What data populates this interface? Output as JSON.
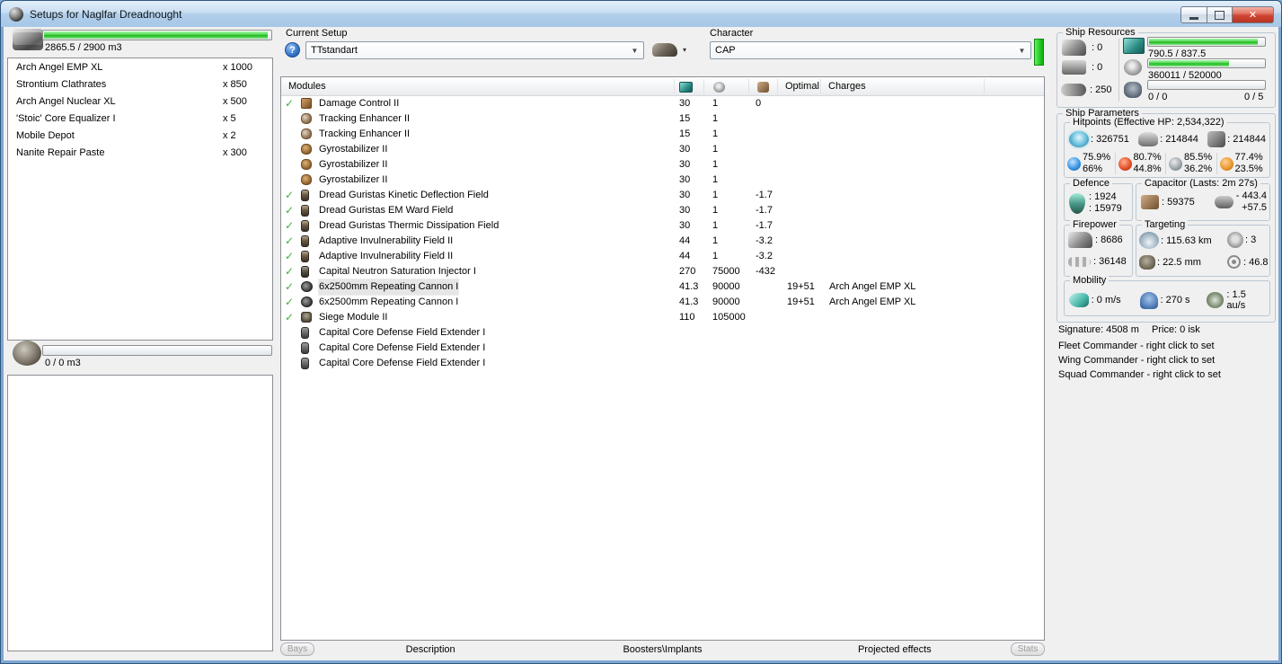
{
  "window": {
    "title": "Setups for Naglfar Dreadnought"
  },
  "left_panel": {
    "cargo": {
      "capacity_label": "2865.5 / 2900 m3",
      "fill_pct": 98.8,
      "items": [
        {
          "name": "Arch Angel EMP XL",
          "qty": "x 1000"
        },
        {
          "name": "Strontium Clathrates",
          "qty": "x 850"
        },
        {
          "name": "Arch Angel Nuclear XL",
          "qty": "x 500"
        },
        {
          "name": "'Stoic' Core Equalizer I",
          "qty": "x 5"
        },
        {
          "name": "Mobile Depot",
          "qty": "x 2"
        },
        {
          "name": "Nanite Repair Paste",
          "qty": "x 300"
        }
      ]
    },
    "drone_bay": {
      "capacity_label": "0 / 0 m3",
      "fill_pct": 0
    }
  },
  "setup_bar": {
    "current_setup_label": "Current Setup",
    "setup_value": "TTstandart",
    "character_label": "Character",
    "character_value": "CAP"
  },
  "modules_table": {
    "title": "Modules",
    "columns": {
      "optimal": "Optimal",
      "charges": "Charges"
    },
    "rows": [
      {
        "active": true,
        "selected": false,
        "icon": "damage-control-icon",
        "name": "Damage Control II",
        "cpu": "30",
        "pg": "1",
        "cap": "0",
        "optimal": "",
        "charges": ""
      },
      {
        "active": false,
        "selected": false,
        "icon": "tracking-enhancer-icon",
        "name": "Tracking Enhancer II",
        "cpu": "15",
        "pg": "1",
        "cap": "",
        "optimal": "",
        "charges": ""
      },
      {
        "active": false,
        "selected": false,
        "icon": "tracking-enhancer-icon",
        "name": "Tracking Enhancer II",
        "cpu": "15",
        "pg": "1",
        "cap": "",
        "optimal": "",
        "charges": ""
      },
      {
        "active": false,
        "selected": false,
        "icon": "gyrostabilizer-icon",
        "name": "Gyrostabilizer II",
        "cpu": "30",
        "pg": "1",
        "cap": "",
        "optimal": "",
        "charges": ""
      },
      {
        "active": false,
        "selected": false,
        "icon": "gyrostabilizer-icon",
        "name": "Gyrostabilizer II",
        "cpu": "30",
        "pg": "1",
        "cap": "",
        "optimal": "",
        "charges": ""
      },
      {
        "active": false,
        "selected": false,
        "icon": "gyrostabilizer-icon",
        "name": "Gyrostabilizer II",
        "cpu": "30",
        "pg": "1",
        "cap": "",
        "optimal": "",
        "charges": ""
      },
      {
        "active": true,
        "selected": false,
        "icon": "shield-hardener-icon",
        "name": "Dread Guristas Kinetic Deflection Field",
        "cpu": "30",
        "pg": "1",
        "cap": "-1.7",
        "optimal": "",
        "charges": ""
      },
      {
        "active": true,
        "selected": false,
        "icon": "shield-hardener-icon",
        "name": "Dread Guristas EM Ward Field",
        "cpu": "30",
        "pg": "1",
        "cap": "-1.7",
        "optimal": "",
        "charges": ""
      },
      {
        "active": true,
        "selected": false,
        "icon": "shield-hardener-icon",
        "name": "Dread Guristas Thermic Dissipation Field",
        "cpu": "30",
        "pg": "1",
        "cap": "-1.7",
        "optimal": "",
        "charges": ""
      },
      {
        "active": true,
        "selected": false,
        "icon": "shield-hardener-icon",
        "name": "Adaptive Invulnerability Field II",
        "cpu": "44",
        "pg": "1",
        "cap": "-3.2",
        "optimal": "",
        "charges": ""
      },
      {
        "active": true,
        "selected": false,
        "icon": "shield-hardener-icon",
        "name": "Adaptive Invulnerability Field II",
        "cpu": "44",
        "pg": "1",
        "cap": "-3.2",
        "optimal": "",
        "charges": ""
      },
      {
        "active": true,
        "selected": false,
        "icon": "injector-icon",
        "name": "Capital Neutron Saturation Injector I",
        "cpu": "270",
        "pg": "75000",
        "cap": "-432",
        "optimal": "",
        "charges": ""
      },
      {
        "active": true,
        "selected": true,
        "icon": "cannon-icon",
        "name": "6x2500mm Repeating Cannon I",
        "cpu": "41.3",
        "pg": "90000",
        "cap": "",
        "optimal": "19+51",
        "charges": "Arch Angel EMP XL"
      },
      {
        "active": true,
        "selected": false,
        "icon": "cannon-icon",
        "name": "6x2500mm Repeating Cannon I",
        "cpu": "41.3",
        "pg": "90000",
        "cap": "",
        "optimal": "19+51",
        "charges": "Arch Angel EMP XL"
      },
      {
        "active": true,
        "selected": false,
        "icon": "siege-module-icon",
        "name": "Siege Module II",
        "cpu": "110",
        "pg": "105000",
        "cap": "",
        "optimal": "",
        "charges": ""
      },
      {
        "active": false,
        "selected": false,
        "icon": "rig-icon",
        "name": "Capital Core Defense Field Extender I",
        "cpu": "",
        "pg": "",
        "cap": "",
        "optimal": "",
        "charges": ""
      },
      {
        "active": false,
        "selected": false,
        "icon": "rig-icon",
        "name": "Capital Core Defense Field Extender I",
        "cpu": "",
        "pg": "",
        "cap": "",
        "optimal": "",
        "charges": ""
      },
      {
        "active": false,
        "selected": false,
        "icon": "rig-icon",
        "name": "Capital Core Defense Field Extender I",
        "cpu": "",
        "pg": "",
        "cap": "",
        "optimal": "",
        "charges": ""
      }
    ]
  },
  "bottom_bar": {
    "bays_button": "Bays",
    "tabs": [
      "Description",
      "Boosters\\Implants",
      "Projected effects"
    ],
    "stats_button": "Stats"
  },
  "ship_resources": {
    "title": "Ship Resources",
    "turrets": ": 0",
    "launchers": ": 0",
    "calibration": ": 250",
    "cpu": {
      "label": "790.5 / 837.5",
      "pct": 94.4
    },
    "powergrid": {
      "label": "360011 / 520000",
      "pct": 69.2
    },
    "drones": {
      "label": "0 / 0",
      "right_label": "0 / 5",
      "pct": 0
    }
  },
  "ship_parameters": {
    "title": "Ship Parameters",
    "hitpoints": {
      "title": "Hitpoints (Effective HP: 2,534,322)",
      "shield": ": 326751",
      "armor": ": 214844",
      "hull": ": 214844",
      "resists": [
        {
          "type": "em",
          "shield": "75.9%",
          "armor": "66%"
        },
        {
          "type": "thermal",
          "shield": "80.7%",
          "armor": "44.8%"
        },
        {
          "type": "kinetic",
          "shield": "85.5%",
          "armor": "36.2%"
        },
        {
          "type": "explosive",
          "shield": "77.4%",
          "armor": "23.5%"
        }
      ]
    },
    "defence": {
      "title": "Defence",
      "value1": ": 1924",
      "value2": ": 15979"
    },
    "capacitor": {
      "title": "Capacitor (Lasts: 2m 27s)",
      "amount": ": 59375",
      "delta_neg": "- 443.4",
      "delta_pos": "+57.5"
    },
    "firepower": {
      "title": "Firepower",
      "volley": ": 8686",
      "dps": ": 36148"
    },
    "targeting": {
      "title": "Targeting",
      "range": ": 115.63 km",
      "max_targets": ": 3",
      "sig_radius": ": 22.5 mm",
      "scan_res": ": 46.8"
    },
    "mobility": {
      "title": "Mobility",
      "speed": ": 0 m/s",
      "align": ": 270 s",
      "warp": ": 1.5 au/s"
    }
  },
  "footer_info": {
    "signature": "Signature: 4508 m",
    "price": "Price: 0 isk",
    "fleet": "Fleet Commander - right click to set",
    "wing": "Wing Commander - right click to set",
    "squad": "Squad Commander - right click to set"
  },
  "colors": {
    "accent_green": "#2cc22c",
    "titlebar_blue": "#bcd6ee",
    "close_red": "#cf4633",
    "check_green": "#43ae3f",
    "selection_gray": "#e6e6e6"
  }
}
